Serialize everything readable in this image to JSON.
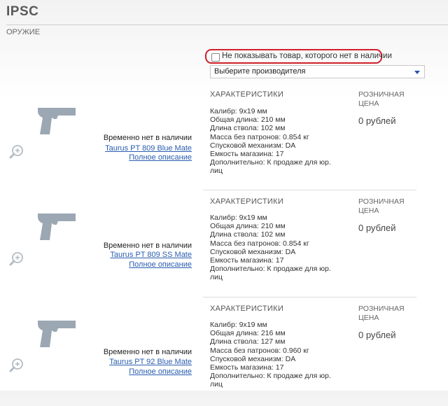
{
  "page": {
    "title": "IPSC",
    "subtitle": "ОРУЖИЕ"
  },
  "filter": {
    "checkbox_label": "Не показывать товар, которого нет в наличии",
    "checked": false
  },
  "manufacturer_select": {
    "selected": "Выберите производителя"
  },
  "colors": {
    "accent_red": "#d2202a",
    "link_blue": "#2a5db0",
    "gun_gray": "#9ba7b3"
  },
  "products": [
    {
      "status": "Временно нет в наличии",
      "name": "Taurus PT 809 Blue Mate",
      "details_link": "Полное описание",
      "specs_title": "ХАРАКТЕРИСТИКИ",
      "specs": [
        "Калибр: 9x19 мм",
        "Общая длина: 210 мм",
        "Длина ствола: 102 мм",
        "Масса без патронов: 0.854 кг",
        "Спусковой механизм: DA",
        "Емкость магазина: 17",
        "Дополнительно: К продаже для юр.",
        "лиц"
      ],
      "price_label_1": "РОЗНИЧНАЯ",
      "price_label_2": "ЦЕНА",
      "price": "0 рублей"
    },
    {
      "status": "Временно нет в наличии",
      "name": "Taurus PT 809 SS Mate",
      "details_link": "Полное описание",
      "specs_title": "ХАРАКТЕРИСТИКИ",
      "specs": [
        "Калибр: 9x19 мм",
        "Общая длина: 210 мм",
        "Длина ствола: 102 мм",
        "Масса без патронов: 0.854 кг",
        "Спусковой механизм: DA",
        "Емкость магазина: 17",
        "Дополнительно: К продаже для юр.",
        "лиц"
      ],
      "price_label_1": "РОЗНИЧНАЯ",
      "price_label_2": "ЦЕНА",
      "price": "0 рублей"
    },
    {
      "status": "Временно нет в наличии",
      "name": "Taurus PT 92 Blue Mate",
      "details_link": "Полное описание",
      "specs_title": "ХАРАКТЕРИСТИКИ",
      "specs": [
        "Калибр: 9x19 мм",
        "Общая длина: 216 мм",
        "Длина ствола: 127 мм",
        "Масса без патронов: 0.960 кг",
        "Спусковой механизм: DA",
        "Емкость магазина: 17",
        "Дополнительно: К продаже для юр.",
        "лиц"
      ],
      "price_label_1": "РОЗНИЧНАЯ",
      "price_label_2": "ЦЕНА",
      "price": "0 рублей"
    }
  ]
}
